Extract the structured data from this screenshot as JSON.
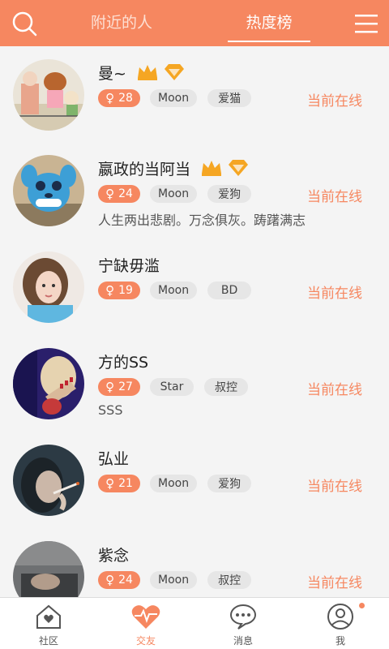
{
  "header": {
    "tabs": [
      {
        "label": "附近的人",
        "active": false
      },
      {
        "label": "热度榜",
        "active": true
      }
    ],
    "icons": [
      "search-icon",
      "menu-icon"
    ]
  },
  "users": [
    {
      "name": "曼~",
      "gender": "♀",
      "age": "28",
      "tags": [
        "Moon",
        "爱猫"
      ],
      "status": "当前在线",
      "bio": "",
      "badges": [
        "crown-icon",
        "diamond-icon"
      ]
    },
    {
      "name": "嬴政的当阿当",
      "gender": "♀",
      "age": "24",
      "tags": [
        "Moon",
        "爱狗"
      ],
      "status": "当前在线",
      "bio": "人生两出悲剧。万念俱灰。踌躇满志",
      "badges": [
        "crown-icon",
        "diamond-icon"
      ]
    },
    {
      "name": "宁缺毋滥",
      "gender": "♀",
      "age": "19",
      "tags": [
        "Moon",
        "BD"
      ],
      "status": "当前在线",
      "bio": "",
      "badges": []
    },
    {
      "name": "方的SS",
      "gender": "♀",
      "age": "27",
      "tags": [
        "Star",
        "叔控"
      ],
      "status": "当前在线",
      "bio": "SSS",
      "badges": []
    },
    {
      "name": "弘业",
      "gender": "♀",
      "age": "21",
      "tags": [
        "Moon",
        "爱狗"
      ],
      "status": "当前在线",
      "bio": "",
      "badges": []
    },
    {
      "name": "紫念",
      "gender": "♀",
      "age": "24",
      "tags": [
        "Moon",
        "叔控"
      ],
      "status": "当前在线",
      "bio": "",
      "badges": []
    }
  ],
  "nav": {
    "items": [
      {
        "label": "社区",
        "icon": "house-heart-icon",
        "active": false
      },
      {
        "label": "交友",
        "icon": "heart-pulse-icon",
        "active": true
      },
      {
        "label": "消息",
        "icon": "chat-bubble-icon",
        "active": false
      },
      {
        "label": "我",
        "icon": "user-icon",
        "active": false,
        "notification_dot": true
      }
    ]
  },
  "colors": {
    "accent": "#f68760",
    "background": "#f4f4f4",
    "tag_bg": "#e6e6e6",
    "crown": "#f5a623"
  }
}
